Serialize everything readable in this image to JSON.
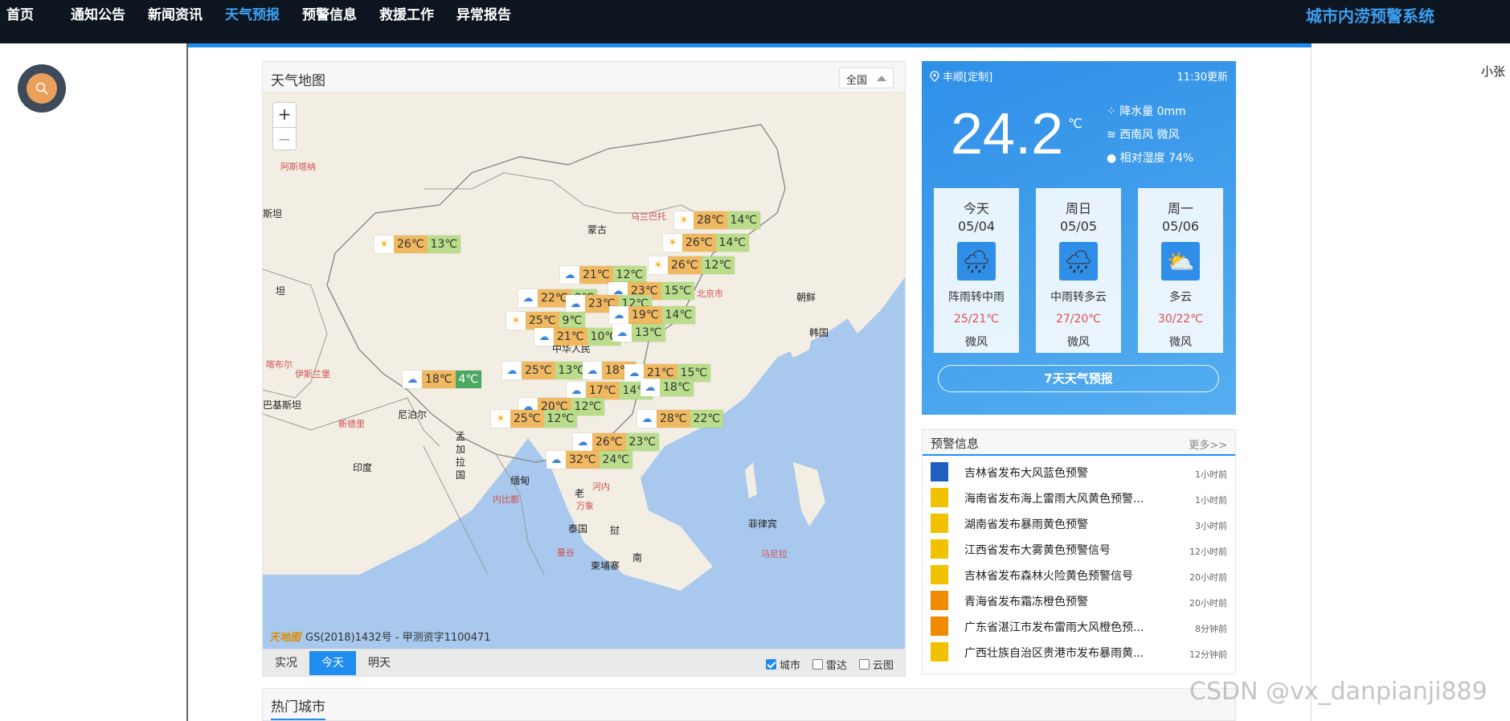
{
  "nav": {
    "items": [
      "首页",
      "通知公告",
      "新闻资讯",
      "天气预报",
      "预警信息",
      "救援工作",
      "异常报告"
    ],
    "active_index": 3,
    "site_title": "城市内涝预警系统"
  },
  "user": {
    "name": "小张"
  },
  "map": {
    "title": "天气地图",
    "region": "全国",
    "zoom_in": "+",
    "zoom_out": "−",
    "copyright_logo": "天地图",
    "copyright": "GS(2018)1432号 - 甲测资字1100471",
    "places": [
      {
        "name": "阿斯塔纳",
        "red": true
      },
      {
        "name": "斯坦",
        "red": false
      },
      {
        "name": "蒙古",
        "red": false,
        "dark": true
      },
      {
        "name": "乌兰巴托",
        "red": true
      },
      {
        "name": "坦",
        "red": false
      },
      {
        "name": "朝鲜",
        "red": false,
        "dark": true
      },
      {
        "name": "韩国",
        "red": false,
        "dark": true
      },
      {
        "name": "北京市",
        "red": true
      },
      {
        "name": "中华人民",
        "red": false,
        "dark": true
      },
      {
        "name": "喀布尔",
        "red": true
      },
      {
        "name": "伊斯兰堡",
        "red": true
      },
      {
        "name": "巴基斯坦",
        "red": false,
        "dark": true
      },
      {
        "name": "尼泊尔",
        "red": false,
        "dark": true
      },
      {
        "name": "新德里",
        "red": true
      },
      {
        "name": "印度",
        "red": false,
        "dark": true
      },
      {
        "name": "孟加拉国",
        "red": false,
        "dark": true
      },
      {
        "name": "缅甸",
        "red": false,
        "dark": true
      },
      {
        "name": "内比都",
        "red": true
      },
      {
        "name": "老",
        "red": false,
        "dark": true
      },
      {
        "name": "万象",
        "red": true
      },
      {
        "name": "河内",
        "red": true
      },
      {
        "name": "泰国",
        "red": false,
        "dark": true
      },
      {
        "name": "曼谷",
        "red": true
      },
      {
        "name": "柬埔寨",
        "red": false,
        "dark": true
      },
      {
        "name": "挝",
        "red": false,
        "dark": true
      },
      {
        "name": "南",
        "red": false,
        "dark": true
      },
      {
        "name": "菲律宾",
        "red": false,
        "dark": true
      },
      {
        "name": "马尼拉",
        "red": true
      }
    ],
    "markers": [
      {
        "icon": "sun",
        "hi": "28℃",
        "lo": "14℃"
      },
      {
        "icon": "sun",
        "hi": "26℃",
        "lo": "14℃"
      },
      {
        "icon": "sun",
        "hi": "26℃",
        "lo": "13℃"
      },
      {
        "icon": "sun",
        "hi": "26℃",
        "lo": "12℃"
      },
      {
        "icon": "rain",
        "hi": "21℃",
        "lo": "12℃"
      },
      {
        "icon": "rain",
        "hi": "23℃",
        "lo": "15℃"
      },
      {
        "icon": "rain",
        "hi": "22℃",
        "lo": "8℃"
      },
      {
        "icon": "rain",
        "hi": "23℃",
        "lo": "12℃"
      },
      {
        "icon": "rain",
        "hi": "19℃",
        "lo": "14℃"
      },
      {
        "icon": "sun",
        "hi": "25℃",
        "lo": "9℃"
      },
      {
        "icon": "rain",
        "hi": "21℃",
        "lo": "10℃"
      },
      {
        "icon": "rain",
        "hi": "",
        "lo": "13℃"
      },
      {
        "icon": "rain",
        "hi": "18℃",
        "lo": "4℃",
        "cold": true
      },
      {
        "icon": "rain",
        "hi": "25℃",
        "lo": "13℃"
      },
      {
        "icon": "rain",
        "hi": "18℃",
        "lo": ""
      },
      {
        "icon": "rain",
        "hi": "21℃",
        "lo": "15℃"
      },
      {
        "icon": "rain",
        "hi": "17℃",
        "lo": "14℃"
      },
      {
        "icon": "rain",
        "hi": "",
        "lo": "18℃"
      },
      {
        "icon": "rain",
        "hi": "20℃",
        "lo": "12℃"
      },
      {
        "icon": "sun",
        "hi": "25℃",
        "lo": "12℃"
      },
      {
        "icon": "rain",
        "hi": "28℃",
        "lo": "22℃"
      },
      {
        "icon": "rain",
        "hi": "26℃",
        "lo": "23℃"
      },
      {
        "icon": "rain",
        "hi": "32℃",
        "lo": "24℃"
      }
    ],
    "tabs": [
      "实况",
      "今天",
      "明天"
    ],
    "active_tab": 1,
    "layers": [
      {
        "label": "城市",
        "checked": true
      },
      {
        "label": "雷达",
        "checked": false
      },
      {
        "label": "云图",
        "checked": false
      }
    ]
  },
  "current": {
    "location": "丰顺[定制]",
    "update": "11:30更新",
    "temp": "24.2",
    "unit": "℃",
    "precip": "降水量 0mm",
    "wind": "西南风 微风",
    "humidity": "相对湿度 74%",
    "days": [
      {
        "name": "今天",
        "date": "05/04",
        "cond": "阵雨转中雨",
        "temp": "25/21℃",
        "wind": "微风",
        "icon": "rain"
      },
      {
        "name": "周日",
        "date": "05/05",
        "cond": "中雨转多云",
        "temp": "27/20℃",
        "wind": "微风",
        "icon": "rain"
      },
      {
        "name": "周一",
        "date": "05/06",
        "cond": "多云",
        "temp": "30/22℃",
        "wind": "微风",
        "icon": "cloud"
      }
    ],
    "seven_day": "7天天气预报"
  },
  "warnings": {
    "title": "预警信息",
    "more": "更多>>",
    "items": [
      {
        "text": "吉林省发布大风蓝色预警",
        "time": "1小时前",
        "color": "#1f5fc0"
      },
      {
        "text": "海南省发布海上雷雨大风黄色预警...",
        "time": "1小时前",
        "color": "#f2c200"
      },
      {
        "text": "湖南省发布暴雨黄色预警",
        "time": "3小时前",
        "color": "#f2c200"
      },
      {
        "text": "江西省发布大雾黄色预警信号",
        "time": "12小时前",
        "color": "#f2c200"
      },
      {
        "text": "吉林省发布森林火险黄色预警信号",
        "time": "20小时前",
        "color": "#f2c200"
      },
      {
        "text": "青海省发布霜冻橙色预警",
        "time": "20小时前",
        "color": "#f08a00"
      },
      {
        "text": "广东省湛江市发布雷雨大风橙色预...",
        "time": "8分钟前",
        "color": "#f08a00"
      },
      {
        "text": "广西壮族自治区贵港市发布暴雨黄...",
        "time": "12分钟前",
        "color": "#f2c200"
      }
    ]
  },
  "hot": {
    "title": "热门城市"
  },
  "watermark": "CSDN @vx_danpianji889"
}
